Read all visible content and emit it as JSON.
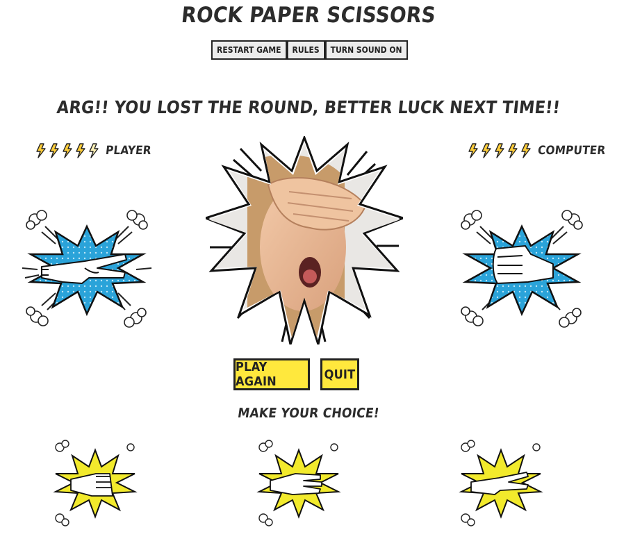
{
  "header": {
    "title": "ROCK PAPER SCISSORS",
    "menu": {
      "restart": "RESTART GAME",
      "rules": "RULES",
      "sound": "TURN SOUND ON"
    }
  },
  "round": {
    "message": "ARG!! YOU LOST THE ROUND, BETTER LUCK NEXT TIME!!"
  },
  "player": {
    "label": "PLAYER",
    "lives": 5,
    "hand": "scissors",
    "burst_color": "#2aa3d9"
  },
  "computer": {
    "label": "COMPUTER",
    "lives": 5,
    "hand": "rock",
    "burst_color": "#2aa3d9"
  },
  "actions": {
    "play_again": "PLAY AGAIN",
    "quit": "QUIT"
  },
  "choices": {
    "prompt": "MAKE YOUR CHOICE!",
    "options": [
      "rock",
      "paper",
      "scissors"
    ],
    "burst_color": "#f2ea2c"
  },
  "icons": {
    "life": "lightning-bolt-icon",
    "result": "facepalm-image"
  },
  "colors": {
    "accent_yellow": "#ffe83d",
    "bolt_fill": "#ffce3a"
  }
}
